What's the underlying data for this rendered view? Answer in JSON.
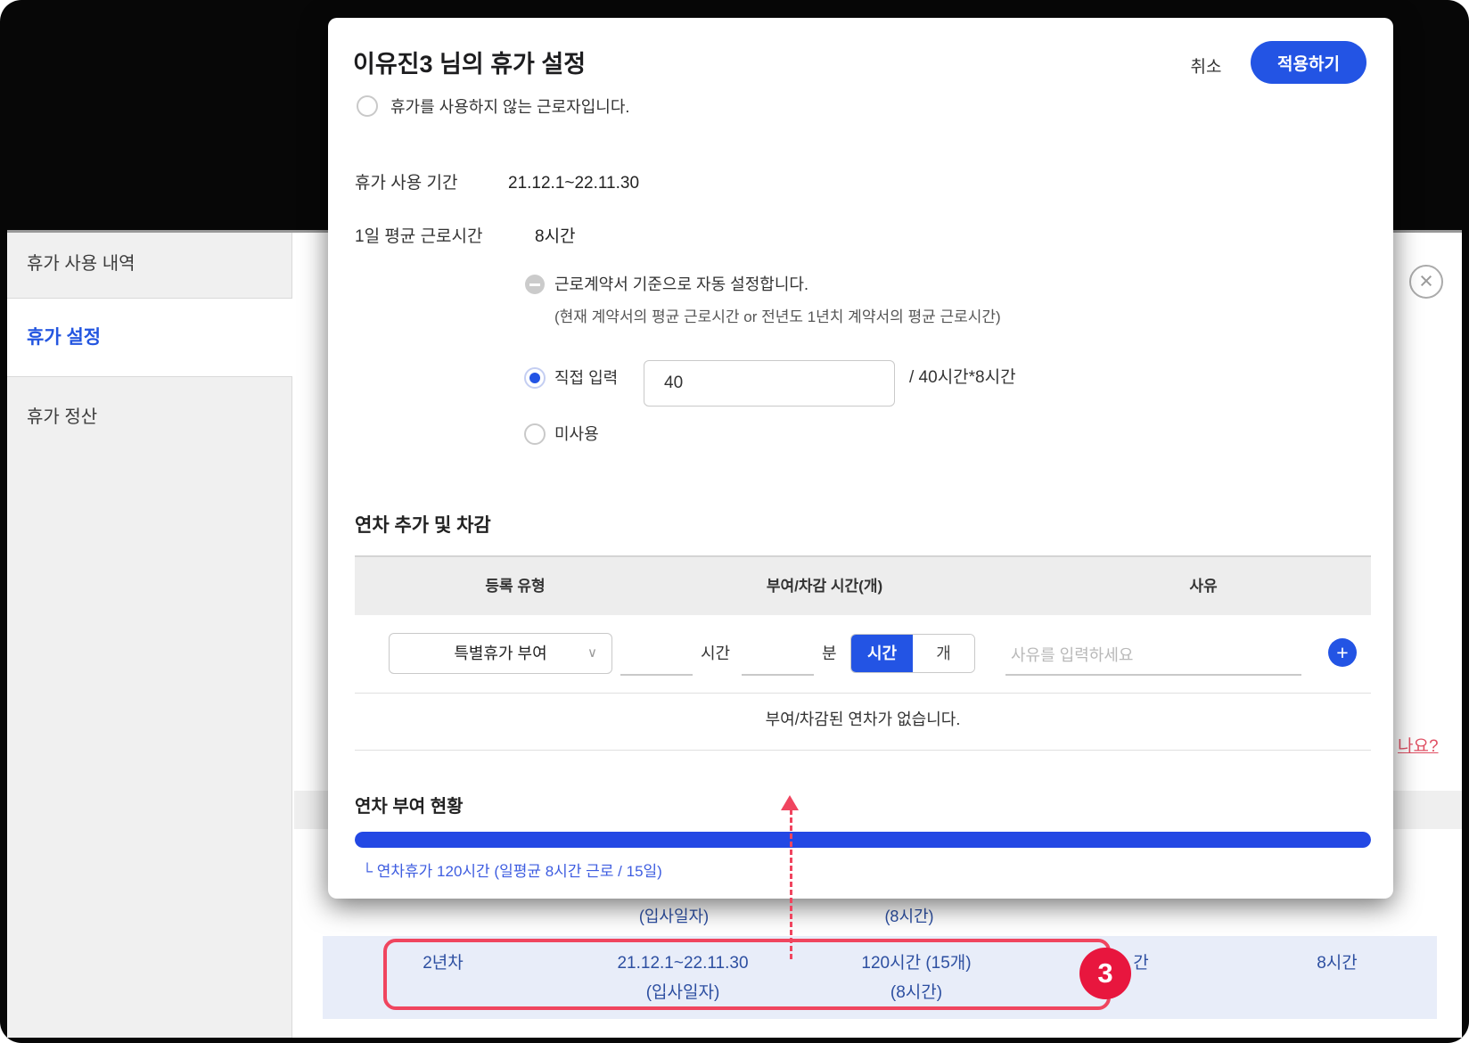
{
  "sidebar": {
    "items": [
      {
        "label": "휴가 사용 내역",
        "active": false
      },
      {
        "label": "휴가 설정",
        "active": true
      },
      {
        "label": "휴가 정산",
        "active": false
      }
    ]
  },
  "page": {
    "partial_link": "나요?",
    "prev_row": {
      "col2": "(입사일자)",
      "col3": "(8시간)"
    },
    "bottom_row": {
      "col1": "2년차",
      "col2_line1": "21.12.1~22.11.30",
      "col2_line2": "(입사일자)",
      "col3_line1": "120시간 (15개)",
      "col3_line2": "(8시간)",
      "col4_fragment": "간",
      "col5": "8시간"
    },
    "annotation_badge": "3",
    "close_icon_glyph": "×"
  },
  "modal": {
    "title": "이유진3 님의 휴가 설정",
    "cancel_label": "취소",
    "apply_label": "적용하기",
    "no_vacation_option": "휴가를 사용하지 않는 근로자입니다.",
    "period": {
      "label": "휴가 사용 기간",
      "value": "21.12.1~22.11.30"
    },
    "avg_work": {
      "label": "1일 평균 근로시간",
      "value": "8시간"
    },
    "work_options": {
      "auto": "근로계약서 기준으로 자동 설정합니다.",
      "auto_note": "(현재 계약서의 평균 근로시간 or 전년도 1년치 계약서의 평균 근로시간)",
      "direct": "직접 입력",
      "direct_value": "40",
      "direct_suffix": "/ 40시간*8시간",
      "unused": "미사용"
    },
    "adjust": {
      "title": "연차 추가 및 차감",
      "headers": [
        "등록 유형",
        "부여/차감 시간(개)",
        "사유"
      ],
      "type_value": "특별휴가 부여",
      "hour_suffix": "시간",
      "minute_suffix": "분",
      "unit_toggle": {
        "hour": "시간",
        "count": "개"
      },
      "reason_placeholder": "사유를 입력하세요",
      "empty_message": "부여/차감된 연차가 없습니다."
    },
    "grant": {
      "title": "연차 부여 현황",
      "progress_percent": 100,
      "caption": "└ 연차휴가 120시간 (일평균 8시간 근로 / 15일)"
    }
  },
  "colors": {
    "primary_blue": "#2354e4",
    "progress_blue": "#2348e4",
    "annotation_red": "#f0455f",
    "badge_red": "#e8163e",
    "row_highlight_bg": "#e8edf9",
    "row_text_navy": "#2d4fa1",
    "link_red": "#e05064"
  }
}
